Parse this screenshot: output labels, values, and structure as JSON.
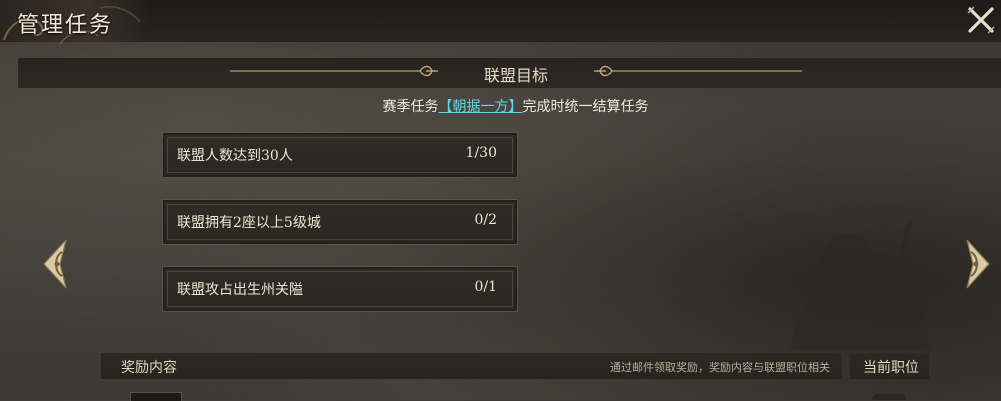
{
  "header": {
    "title": "管理任务",
    "close_icon": "close-x-icon"
  },
  "section": {
    "title": "联盟目标",
    "subtitle_prefix": "赛季任务",
    "subtitle_link": "【朝据一方】",
    "subtitle_suffix": "完成时统一结算任务"
  },
  "tasks": [
    {
      "name": "联盟人数达到30人",
      "progress": "1/30"
    },
    {
      "name": "联盟拥有2座以上5级城",
      "progress": "0/2"
    },
    {
      "name": "联盟攻占出生州关隘",
      "progress": "0/1"
    }
  ],
  "nav": {
    "prev_icon": "ornate-left-arrow-icon",
    "next_icon": "ornate-right-arrow-icon"
  },
  "reward": {
    "title": "奖励内容",
    "note": "通过邮件领取奖励，奖励内容与联盟职位相关"
  },
  "position": {
    "title": "当前职位"
  },
  "colors": {
    "accent_link": "#5fd6e8",
    "gold": "#b7a27a",
    "panel": "#2c2823"
  }
}
